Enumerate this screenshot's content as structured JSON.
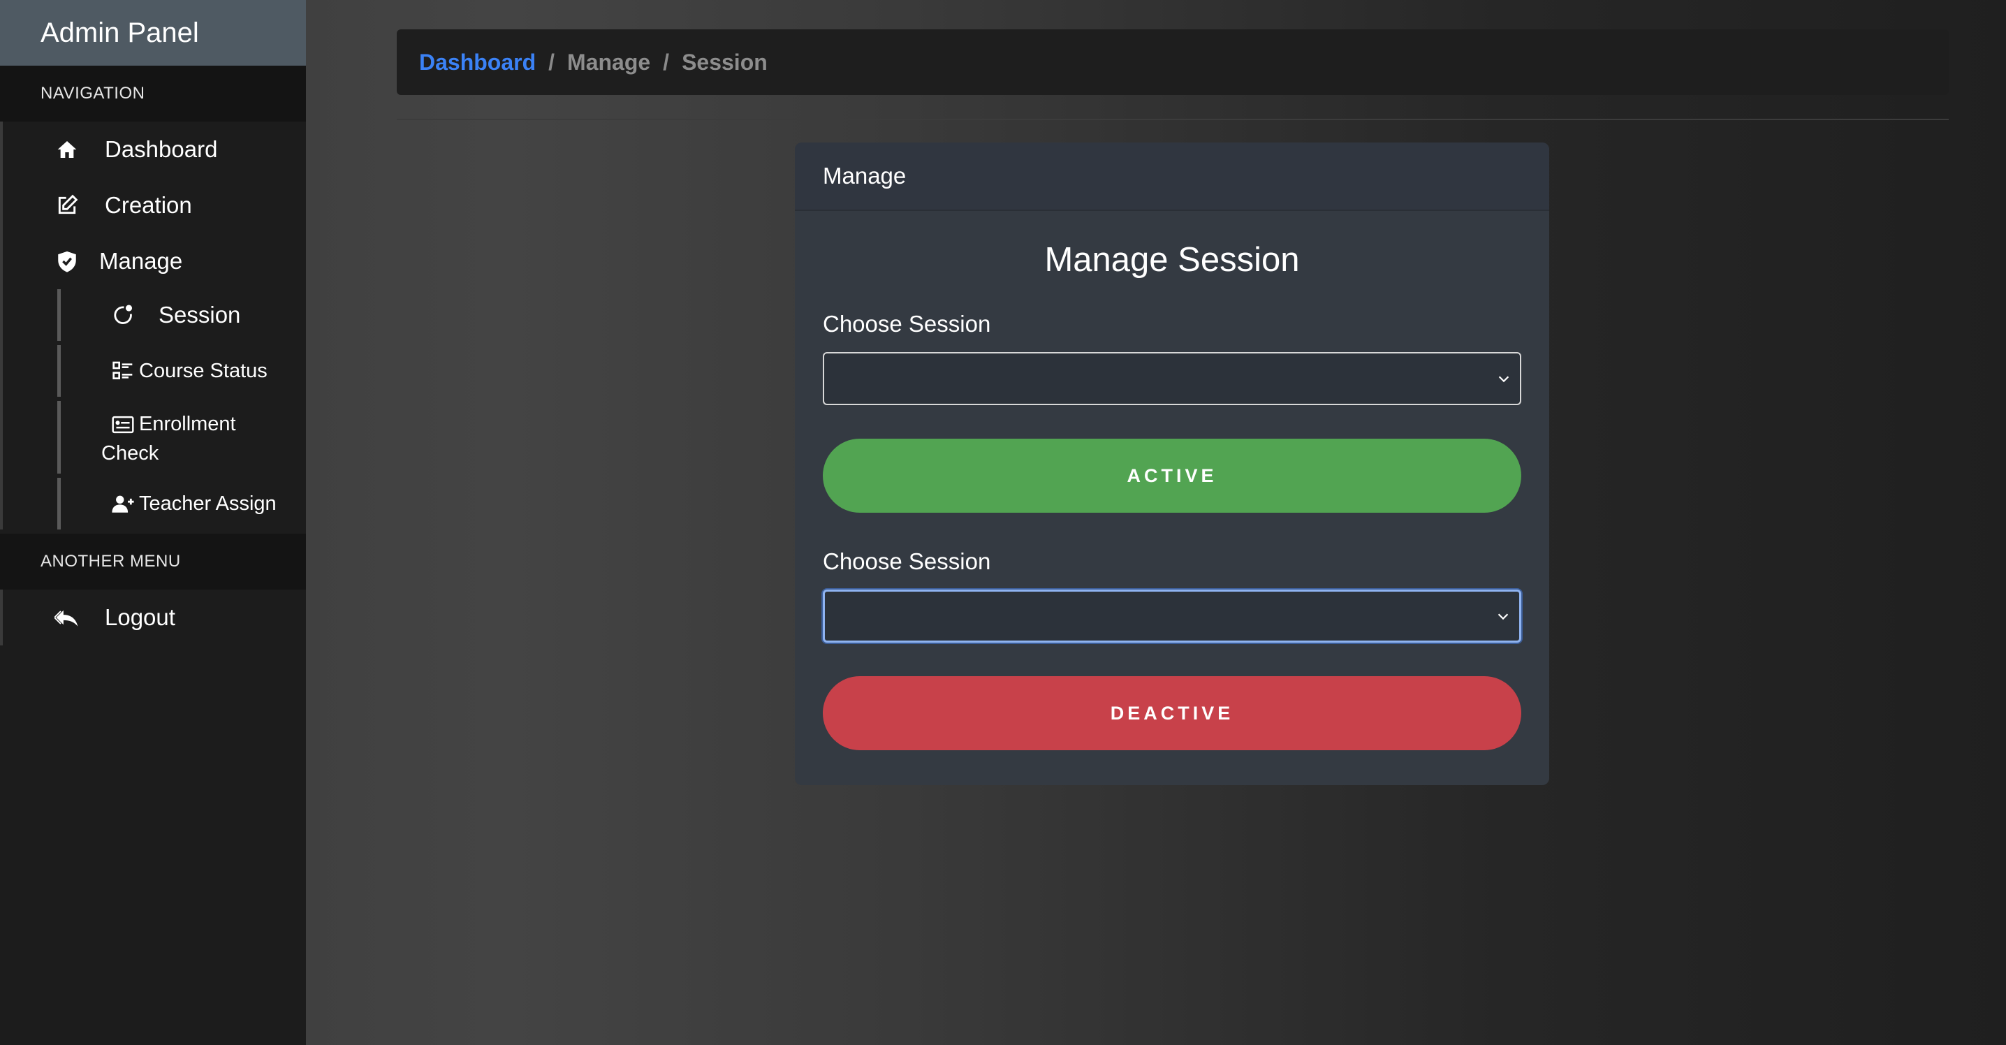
{
  "sidebar": {
    "brand": "Admin Panel",
    "navigation_heading": "NAVIGATION",
    "items": {
      "dashboard": "Dashboard",
      "creation": "Creation",
      "manage": "Manage"
    },
    "manage_subitems": {
      "session": "Session",
      "course_status": "Course Status",
      "enrollment_check": "Enrollment",
      "enrollment_check_line2": "Check",
      "teacher_assign": "Teacher Assign"
    },
    "another_menu_heading": "ANOTHER MENU",
    "logout": "Logout"
  },
  "breadcrumb": {
    "items": [
      "Dashboard",
      "Manage",
      "Session"
    ],
    "separator": "/"
  },
  "card": {
    "header": "Manage",
    "title": "Manage Session",
    "activate_section": {
      "label": "Choose Session",
      "selected": "",
      "button": "ACTIVE"
    },
    "deactivate_section": {
      "label": "Choose Session",
      "selected": "",
      "button": "DEACTIVE"
    }
  },
  "colors": {
    "link": "#3b82f6",
    "active_button": "#52a452",
    "deactive_button": "#c8414a",
    "brand_bar": "#4f5a63"
  }
}
